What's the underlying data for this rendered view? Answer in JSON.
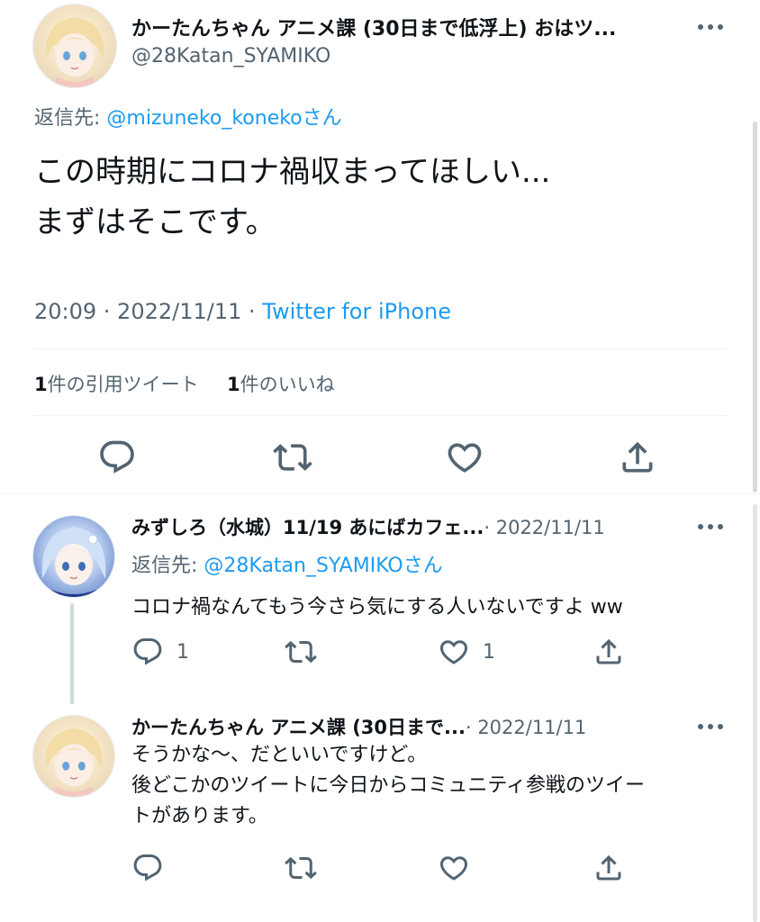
{
  "main_tweet": {
    "display_name": "かーたんちゃん アニメ課 (30日まで低浮上) おはツ...",
    "handle": "@28Katan_SYAMIKO",
    "reply_prefix": "返信先: ",
    "reply_to": "@mizuneko_koneko",
    "reply_suffix": "さん",
    "text_line1": "この時期にコロナ禍収まってほしい...",
    "text_line2": "まずはそこです。",
    "time": "20:09 · 2022/11/11 · ",
    "source": "Twitter for iPhone",
    "quote_count": "1",
    "quote_label": "件の引用ツイート",
    "like_count": "1",
    "like_label": "件のいいね"
  },
  "replies": [
    {
      "display_name": "みずしろ（水城）11/19 あにばカフェ...",
      "date": "· 2022/11/11",
      "reply_prefix": "返信先: ",
      "reply_to": "@28Katan_SYAMIKO",
      "reply_suffix": "さん",
      "text": "コロナ禍なんてもう今さら気にする人いないですよ ww",
      "reply_count": "1",
      "like_count": "1"
    },
    {
      "display_name": "かーたんちゃん アニメ課 (30日まで...",
      "date": "· 2022/11/11",
      "text_line1": "そうかな〜、だといいですけど。",
      "text_line2": "後どこかのツイートに今日からコミュニティ参戦のツイー",
      "text_line3": "トがあります。"
    }
  ],
  "icons": [
    "more-icon",
    "reply-icon",
    "retweet-icon",
    "like-icon",
    "share-icon"
  ],
  "colors": {
    "accent": "#1d9bf0",
    "secondary": "#536471",
    "divider": "#eff3f4"
  }
}
